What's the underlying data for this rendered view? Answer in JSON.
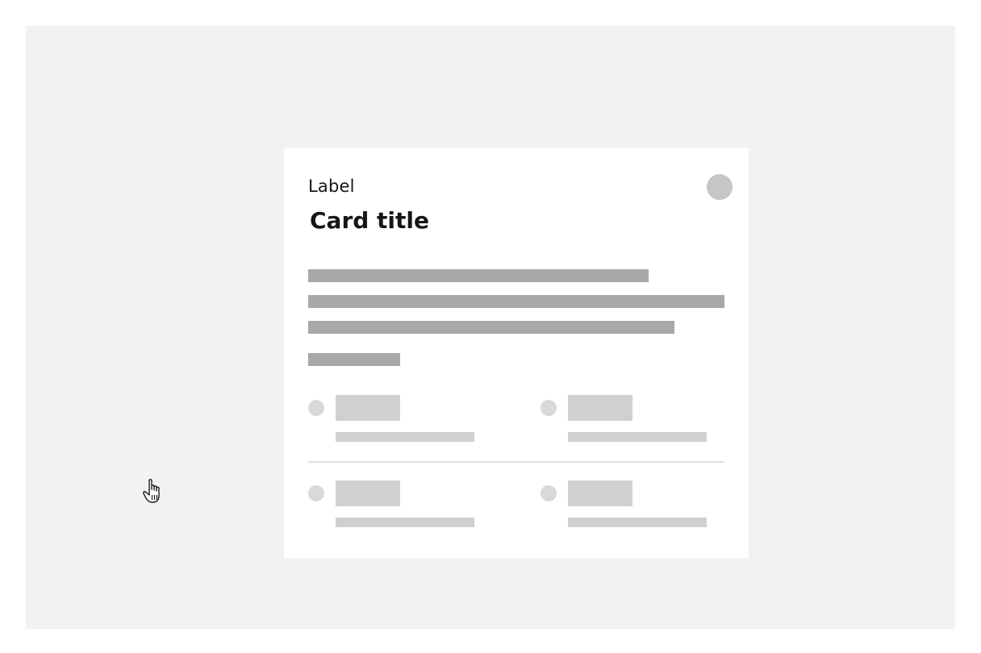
{
  "card": {
    "label": "Label",
    "title": "Card title"
  },
  "cursor": {
    "icon": "hand-pointer-icon"
  },
  "colors": {
    "canvas_background": "#f2f2f2",
    "card_background": "#ffffff",
    "text_primary": "#161616",
    "skeleton_dark": "#a8a8a8",
    "skeleton_light": "#d0d0d0",
    "avatar": "#c6c6c6"
  }
}
